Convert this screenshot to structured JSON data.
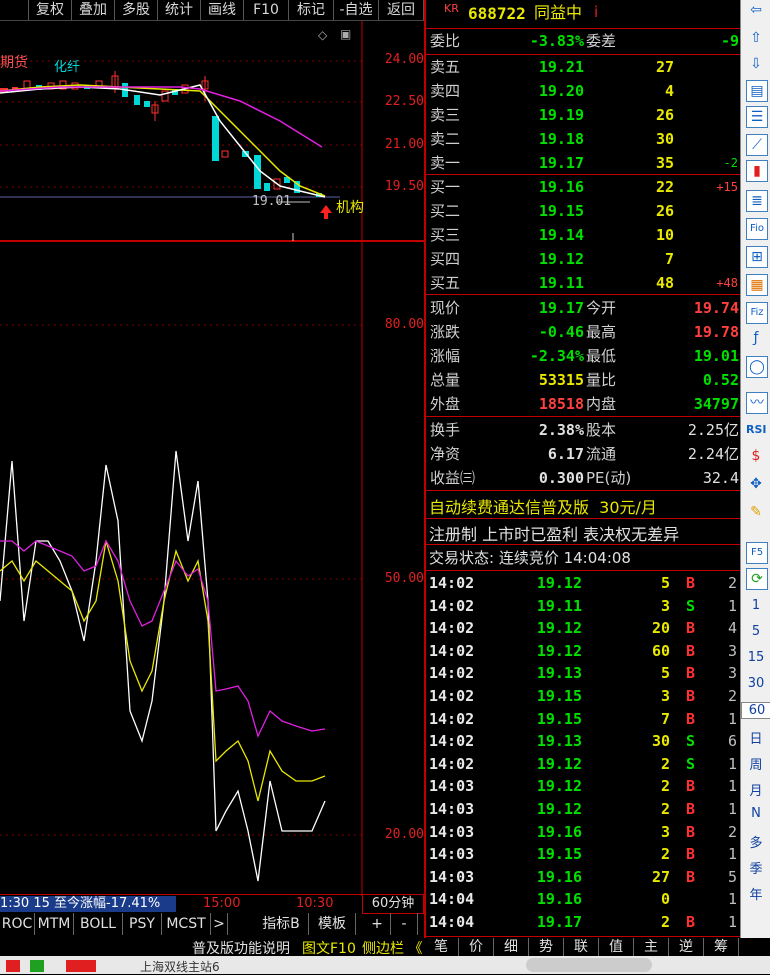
{
  "toolbar": {
    "buttons": [
      "复权",
      "叠加",
      "多股",
      "统计",
      "画线",
      "F10",
      "标记",
      "-自选",
      "返回"
    ]
  },
  "stock": {
    "prefix": "KR",
    "code": "688722",
    "name": "同益中",
    "info_icon": "i"
  },
  "chart": {
    "label_indicator": "化纤",
    "label_left": "期货",
    "price_axis": [
      "24.00",
      "22.50",
      "21.00",
      "19.50"
    ],
    "low_marker": "19.01",
    "right_marker": "机构",
    "osc_axis": [
      "80.00",
      "50.00",
      "20.00"
    ],
    "time_info": "1:30 15 至今涨幅-17.41%",
    "time_ticks": [
      "15:00",
      "10:30"
    ],
    "period": "60分钟",
    "indicator_tabs": [
      "ROC",
      "MTM",
      "BOLL",
      "PSY",
      "MCST",
      ">"
    ],
    "indicator_btn": "指标B",
    "template_btn": "模板",
    "plus": "+",
    "minus": "-",
    "footer_text": "普及版功能说明",
    "footer_f10": "图文F10",
    "footer_side": "侧边栏 《",
    "colors": {
      "up": "#ff3030",
      "down": "#00d8d8",
      "ma1": "#ffffff",
      "ma2": "#e8e800",
      "ma3": "#e020e0"
    }
  },
  "quote": {
    "weibi_label": "委比",
    "weibi_value": "-3.83%",
    "weicha_label": "委差",
    "weicha_value": "-9",
    "asks": [
      {
        "label": "卖五",
        "price": "19.21",
        "vol": "27",
        "chg": ""
      },
      {
        "label": "卖四",
        "price": "19.20",
        "vol": "4",
        "chg": ""
      },
      {
        "label": "卖三",
        "price": "19.19",
        "vol": "26",
        "chg": ""
      },
      {
        "label": "卖二",
        "price": "19.18",
        "vol": "30",
        "chg": ""
      },
      {
        "label": "卖一",
        "price": "19.17",
        "vol": "35",
        "chg": "-2"
      }
    ],
    "bids": [
      {
        "label": "买一",
        "price": "19.16",
        "vol": "22",
        "chg": "+15"
      },
      {
        "label": "买二",
        "price": "19.15",
        "vol": "26",
        "chg": ""
      },
      {
        "label": "买三",
        "price": "19.14",
        "vol": "10",
        "chg": ""
      },
      {
        "label": "买四",
        "price": "19.12",
        "vol": "7",
        "chg": ""
      },
      {
        "label": "买五",
        "price": "19.11",
        "vol": "48",
        "chg": "+48"
      }
    ],
    "stats": [
      {
        "l1": "现价",
        "v1": "19.17",
        "c1": "#00e000",
        "l2": "今开",
        "v2": "19.74",
        "c2": "#ff4040"
      },
      {
        "l1": "涨跌",
        "v1": "-0.46",
        "c1": "#00e000",
        "l2": "最高",
        "v2": "19.78",
        "c2": "#ff4040"
      },
      {
        "l1": "涨幅",
        "v1": "-2.34%",
        "c1": "#00e000",
        "l2": "最低",
        "v2": "19.01",
        "c2": "#00e000"
      },
      {
        "l1": "总量",
        "v1": "53315",
        "c1": "#e8e800",
        "l2": "量比",
        "v2": "0.52",
        "c2": "#00e000"
      },
      {
        "l1": "外盘",
        "v1": "18518",
        "c1": "#ff4040",
        "l2": "内盘",
        "v2": "34797",
        "c2": "#00e000"
      }
    ],
    "fund": [
      {
        "l1": "换手",
        "v1": "2.38%",
        "l2": "股本",
        "v2": "2.25亿"
      },
      {
        "l1": "净资",
        "v1": "6.17",
        "l2": "流通",
        "v2": "2.24亿"
      },
      {
        "l1": "收益㈢",
        "v1": "0.300",
        "l2": "PE(动)",
        "v2": "32.4"
      }
    ],
    "ad_text": "自动续费通达信普及版  30元/月",
    "note_text": "注册制 上市时已盈利 表决权无差异",
    "trade_status": "交易状态: 连续竞价 14:04:08",
    "ticks": [
      {
        "t": "14:02",
        "p": "19.12",
        "v": "5",
        "bs": "B",
        "n": "2"
      },
      {
        "t": "14:02",
        "p": "19.11",
        "v": "3",
        "bs": "S",
        "n": "1"
      },
      {
        "t": "14:02",
        "p": "19.12",
        "v": "20",
        "bs": "B",
        "n": "4"
      },
      {
        "t": "14:02",
        "p": "19.12",
        "v": "60",
        "bs": "B",
        "n": "3"
      },
      {
        "t": "14:02",
        "p": "19.13",
        "v": "5",
        "bs": "B",
        "n": "3"
      },
      {
        "t": "14:02",
        "p": "19.15",
        "v": "3",
        "bs": "B",
        "n": "2"
      },
      {
        "t": "14:02",
        "p": "19.15",
        "v": "7",
        "bs": "B",
        "n": "1"
      },
      {
        "t": "14:02",
        "p": "19.13",
        "v": "30",
        "bs": "S",
        "n": "6"
      },
      {
        "t": "14:02",
        "p": "19.12",
        "v": "2",
        "bs": "S",
        "n": "1"
      },
      {
        "t": "14:03",
        "p": "19.12",
        "v": "2",
        "bs": "B",
        "n": "1"
      },
      {
        "t": "14:03",
        "p": "19.12",
        "v": "2",
        "bs": "B",
        "n": "1"
      },
      {
        "t": "14:03",
        "p": "19.16",
        "v": "3",
        "bs": "B",
        "n": "2"
      },
      {
        "t": "14:03",
        "p": "19.15",
        "v": "2",
        "bs": "B",
        "n": "1"
      },
      {
        "t": "14:03",
        "p": "19.16",
        "v": "27",
        "bs": "B",
        "n": "5"
      },
      {
        "t": "14:04",
        "p": "19.16",
        "v": "0",
        "bs": "",
        "n": "1"
      },
      {
        "t": "14:04",
        "p": "19.17",
        "v": "2",
        "bs": "B",
        "n": "1"
      }
    ],
    "bottom_tabs": [
      "笔",
      "价",
      "细",
      "势",
      "联",
      "值",
      "主",
      "逆",
      "筹"
    ]
  },
  "sidebar": {
    "periods": [
      "1",
      "5",
      "15",
      "30",
      "60",
      "日",
      "周",
      "月",
      "N",
      "多",
      "季",
      "年"
    ],
    "rsi": "RSI",
    "f5": "F5",
    "f10": "Fio",
    "f12": "Fiz"
  },
  "statusbar": {
    "text": "上海双线主站6"
  }
}
